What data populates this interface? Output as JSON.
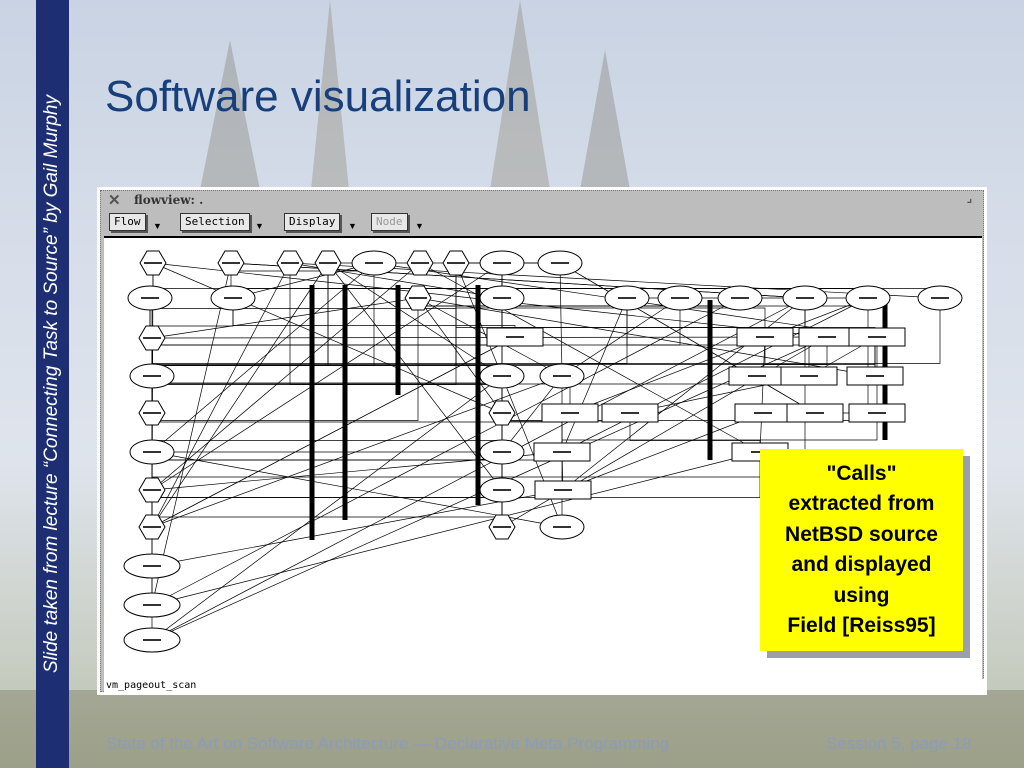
{
  "slide": {
    "side_credit": "Slide taken from lecture “Connecting Task to Source” by Gail Murphy",
    "title": "Software visualization",
    "footer_left": "State of the Art on Software Architecture — Declarative Meta Programming",
    "footer_right": "Session 5, page 18"
  },
  "window": {
    "title": "flowview: .",
    "menus": [
      {
        "label": "Flow",
        "enabled": true
      },
      {
        "label": "Selection",
        "enabled": true
      },
      {
        "label": "Display",
        "enabled": true
      },
      {
        "label": "Node",
        "enabled": false
      }
    ],
    "status": "vm_pageout_scan"
  },
  "callout": {
    "lines": [
      "\"Calls\"",
      "extracted from",
      "NetBSD source",
      "and displayed",
      "using",
      "Field [Reiss95]"
    ]
  },
  "colors": {
    "sidebar": "#1d2f72",
    "title": "#173f7c",
    "callout": "#ffff00"
  }
}
